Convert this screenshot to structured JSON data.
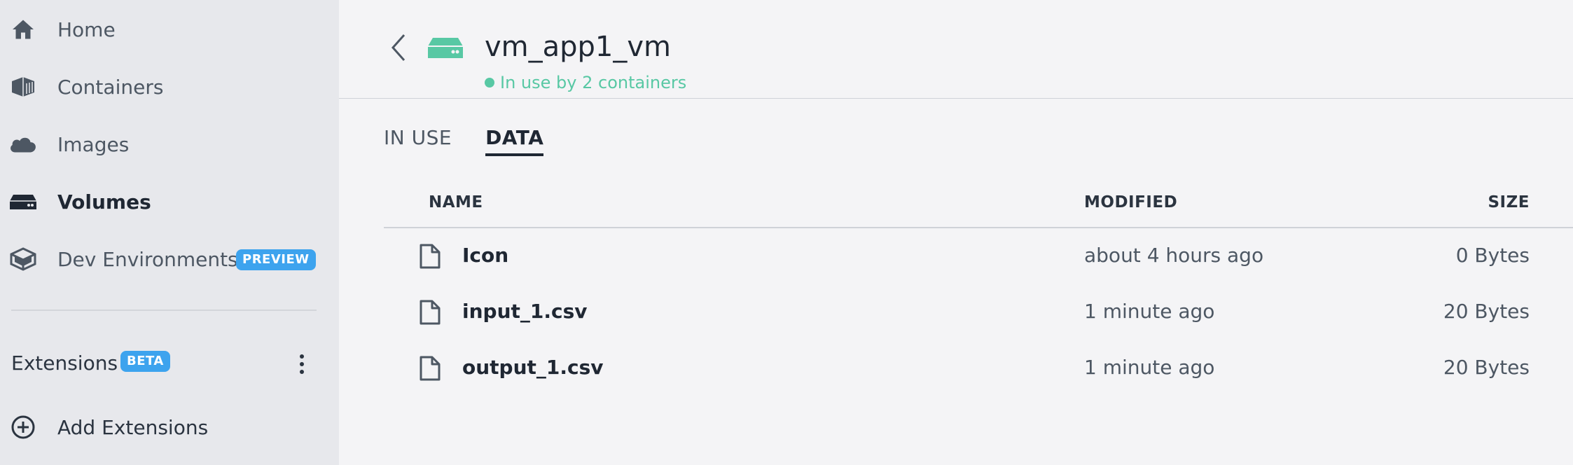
{
  "sidebar": {
    "items": [
      {
        "label": "Home",
        "icon": "home-icon"
      },
      {
        "label": "Containers",
        "icon": "container-icon"
      },
      {
        "label": "Images",
        "icon": "cloud-icon"
      },
      {
        "label": "Volumes",
        "icon": "volume-icon"
      },
      {
        "label": "Dev Environments",
        "icon": "dev-environments-icon",
        "badge": "PREVIEW"
      }
    ],
    "extensions": {
      "label": "Extensions",
      "badge": "BETA",
      "add_label": "Add Extensions"
    }
  },
  "volume": {
    "name": "vm_app1_vm",
    "status": "In use by 2 containers"
  },
  "tabs": [
    {
      "label": "IN USE"
    },
    {
      "label": "DATA"
    }
  ],
  "table": {
    "headers": {
      "name": "NAME",
      "modified": "MODIFIED",
      "size": "SIZE"
    },
    "rows": [
      {
        "name": "Icon",
        "modified": "about 4 hours ago",
        "size": "0 Bytes"
      },
      {
        "name": "input_1.csv",
        "modified": "1 minute ago",
        "size": "20 Bytes"
      },
      {
        "name": "output_1.csv",
        "modified": "1 minute ago",
        "size": "20 Bytes"
      }
    ]
  },
  "colors": {
    "accent_green": "#58c8a4",
    "badge_blue": "#3da3ee",
    "sidebar_bg": "#e7e8ec",
    "main_bg": "#f4f4f6"
  }
}
